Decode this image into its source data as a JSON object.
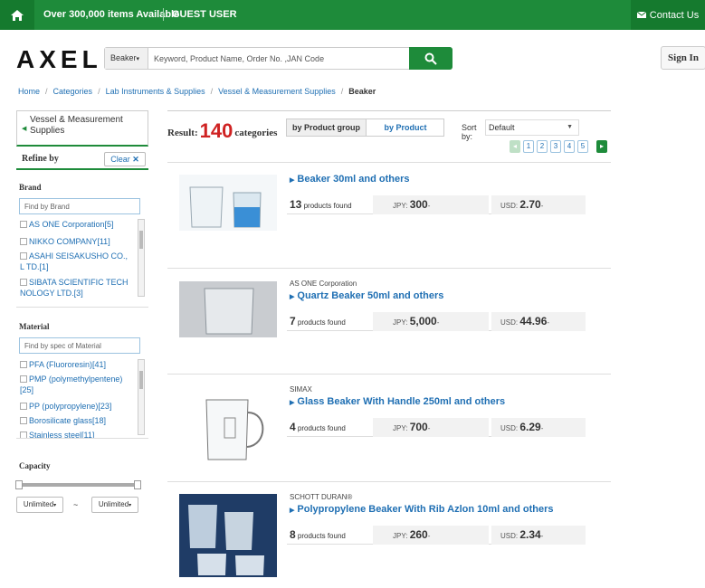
{
  "topbar": {
    "items_text": "Over 300,000 items Available",
    "guest": "GUEST USER",
    "contact": "Contact Us"
  },
  "header": {
    "logo": "AXEL",
    "search_category": "Beaker",
    "search_placeholder": "Keyword, Product Name, Order No. ,JAN Code",
    "signin": "Sign In"
  },
  "breadcrumb": [
    "Home",
    "Categories",
    "Lab Instruments & Supplies",
    "Vessel & Measurement Supplies",
    "Beaker"
  ],
  "sidebar": {
    "parent": "Vessel & Measurement Supplies",
    "refine": "Refine by",
    "clear": "Clear",
    "brand": {
      "title": "Brand",
      "placeholder": "Find by Brand",
      "items": [
        "AS ONE Corporation[5]",
        "NIKKO COMPANY[11]",
        "ASAHI SEISAKUSHO CO., L TD.[1]",
        "SIBATA SCIENTIFIC TECH NOLOGY LTD.[3]"
      ]
    },
    "material": {
      "title": "Material",
      "placeholder": "Find by spec of Material",
      "items": [
        "PFA (Fluororesin)[41]",
        "PMP (polymethylpentene)[25]",
        "PP (polypropylene)[23]",
        "Borosilicate glass[18]",
        "Stainless steel[11]"
      ]
    },
    "capacity": {
      "title": "Capacity",
      "min": "Unlimited",
      "max": "Unlimited",
      "tilde": "~"
    }
  },
  "results": {
    "label": "Result:",
    "count": "140",
    "suffix": "categories",
    "tab_group": "by Product group",
    "tab_product": "by Product",
    "sort_label": "Sort by:",
    "sort_value": "Default",
    "pages": [
      "1",
      "2",
      "3",
      "4",
      "5"
    ]
  },
  "products": [
    {
      "maker": "",
      "name": "Beaker 30ml and others",
      "count": "13",
      "found": "products found",
      "jpy_label": "JPY:",
      "jpy": "300",
      "usd_label": "USD:",
      "usd": "2.70"
    },
    {
      "maker": "AS ONE Corporation",
      "name": "Quartz Beaker 50ml and others",
      "count": "7",
      "found": "products found",
      "jpy_label": "JPY:",
      "jpy": "5,000",
      "usd_label": "USD:",
      "usd": "44.96"
    },
    {
      "maker": "SIMAX",
      "name": "Glass Beaker With Handle 250ml and others",
      "count": "4",
      "found": "products found",
      "jpy_label": "JPY:",
      "jpy": "700",
      "usd_label": "USD:",
      "usd": "6.29"
    },
    {
      "maker": "SCHOTT DURAN®",
      "name": "Polypropylene Beaker With Rib Azlon 10ml and others",
      "count": "8",
      "found": "products found",
      "jpy_label": "JPY:",
      "jpy": "260",
      "usd_label": "USD:",
      "usd": "2.34"
    }
  ],
  "colors": {
    "brand_green": "#1e8b3a",
    "link_blue": "#1f6fb3",
    "result_red": "#cf2222"
  }
}
